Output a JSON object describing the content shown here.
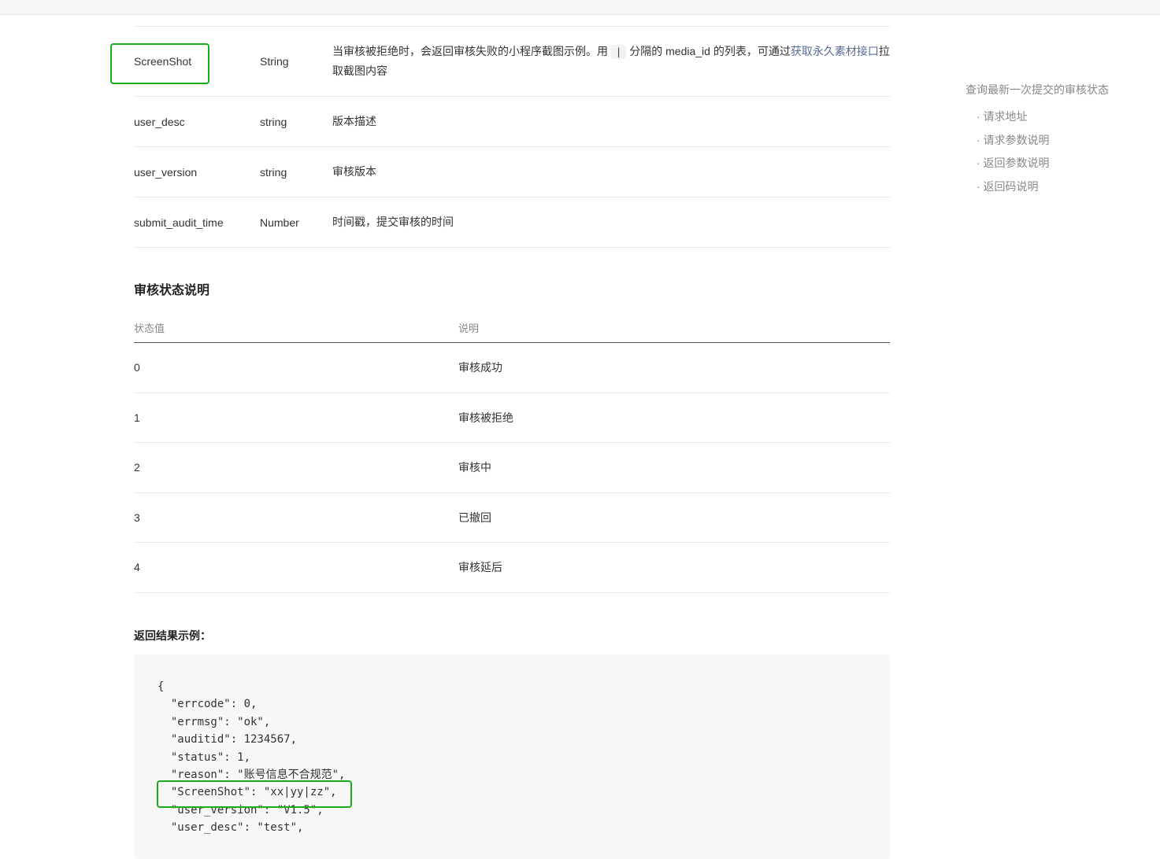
{
  "params": [
    {
      "name": "ScreenShot",
      "type": "String",
      "desc_before": "当审核被拒绝时，会返回审核失败的小程序截图示例。用",
      "desc_code": "|",
      "desc_middle": "分隔的 media_id 的列表，可通过",
      "desc_link": "获取永久素材接口",
      "desc_after": "拉取截图内容"
    },
    {
      "name": "user_desc",
      "type": "string",
      "desc": "版本描述"
    },
    {
      "name": "user_version",
      "type": "string",
      "desc": "审核版本"
    },
    {
      "name": "submit_audit_time",
      "type": "Number",
      "desc": "时间戳，提交审核的时间"
    }
  ],
  "status_section": {
    "title": "审核状态说明",
    "headers": [
      "状态值",
      "说明"
    ],
    "rows": [
      {
        "value": "0",
        "desc": "审核成功"
      },
      {
        "value": "1",
        "desc": "审核被拒绝"
      },
      {
        "value": "2",
        "desc": "审核中"
      },
      {
        "value": "3",
        "desc": "已撤回"
      },
      {
        "value": "4",
        "desc": "审核延后"
      }
    ]
  },
  "example": {
    "title": "返回结果示例：",
    "lines": [
      "{",
      "  \"errcode\": 0,",
      "  \"errmsg\": \"ok\",",
      "  \"auditid\": 1234567,",
      "  \"status\": 1,",
      "  \"reason\": \"账号信息不合规范\",",
      "  \"ScreenShot\": \"xx|yy|zz\",",
      "  \"user_version\": \"V1.5\",",
      "  \"user_desc\": \"test\","
    ]
  },
  "toc": {
    "title": "查询最新一次提交的审核状态",
    "items": [
      "· 请求地址",
      "· 请求参数说明",
      "· 返回参数说明",
      "· 返回码说明"
    ]
  }
}
